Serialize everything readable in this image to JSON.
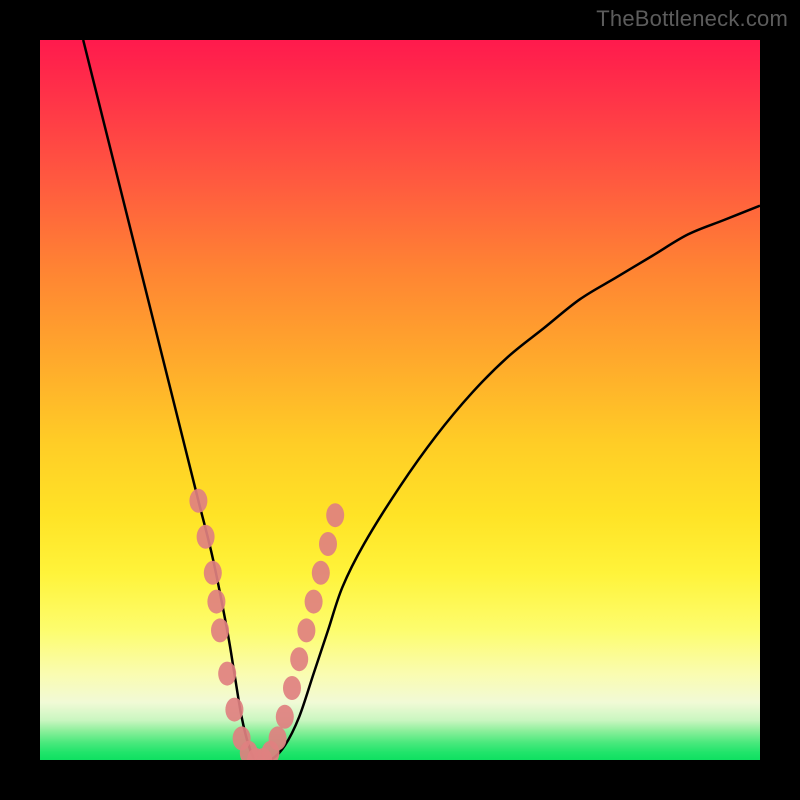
{
  "watermark": {
    "text": "TheBottleneck.com"
  },
  "colors": {
    "curve_stroke": "#000000",
    "marker_fill": "#e08080",
    "gradient_top": "#ff1a4d",
    "gradient_mid": "#ffe326",
    "gradient_bottom": "#0fe061",
    "frame": "#000000"
  },
  "chart_data": {
    "type": "line",
    "title": "",
    "xlabel": "",
    "ylabel": "",
    "xlim": [
      0,
      100
    ],
    "ylim": [
      0,
      100
    ],
    "axes_visible": false,
    "background": "vertical-gradient-red-to-green",
    "series": [
      {
        "name": "bottleneck-curve",
        "x": [
          6,
          8,
          10,
          12,
          14,
          16,
          18,
          20,
          22,
          24,
          26,
          27,
          28,
          29,
          30,
          32,
          34,
          36,
          38,
          40,
          42,
          45,
          50,
          55,
          60,
          65,
          70,
          75,
          80,
          85,
          90,
          95,
          100
        ],
        "y": [
          100,
          92,
          84,
          76,
          68,
          60,
          52,
          44,
          36,
          28,
          18,
          12,
          6,
          2,
          0,
          0,
          2,
          6,
          12,
          18,
          24,
          30,
          38,
          45,
          51,
          56,
          60,
          64,
          67,
          70,
          73,
          75,
          77
        ]
      }
    ],
    "markers": {
      "name": "highlighted-points",
      "note": "pink dots clustered near the valley of the curve",
      "points": [
        {
          "x": 22,
          "y": 36
        },
        {
          "x": 23,
          "y": 31
        },
        {
          "x": 24,
          "y": 26
        },
        {
          "x": 24.5,
          "y": 22
        },
        {
          "x": 25,
          "y": 18
        },
        {
          "x": 26,
          "y": 12
        },
        {
          "x": 27,
          "y": 7
        },
        {
          "x": 28,
          "y": 3
        },
        {
          "x": 29,
          "y": 1
        },
        {
          "x": 30,
          "y": 0
        },
        {
          "x": 31,
          "y": 0
        },
        {
          "x": 32,
          "y": 1
        },
        {
          "x": 33,
          "y": 3
        },
        {
          "x": 34,
          "y": 6
        },
        {
          "x": 35,
          "y": 10
        },
        {
          "x": 36,
          "y": 14
        },
        {
          "x": 37,
          "y": 18
        },
        {
          "x": 38,
          "y": 22
        },
        {
          "x": 39,
          "y": 26
        },
        {
          "x": 40,
          "y": 30
        },
        {
          "x": 41,
          "y": 34
        }
      ]
    }
  }
}
